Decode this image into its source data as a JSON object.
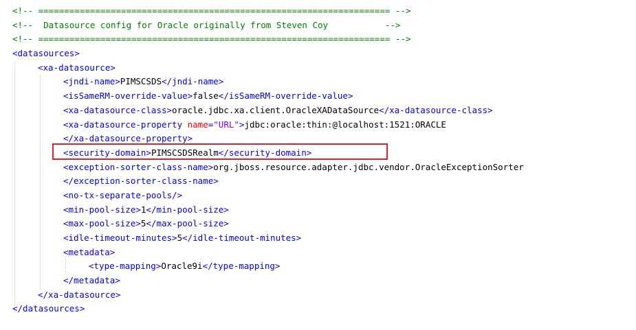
{
  "code_view": {
    "colors": {
      "comment": "#008000",
      "tag": "#0000ff",
      "text": "#000000",
      "attribute": "#ff0000",
      "attribute_value": "#8000ff",
      "highlight_box": "#e0202c"
    },
    "highlighted_line_index": 9,
    "lines": [
      {
        "indent": 0,
        "tokens": [
          {
            "t": "comment",
            "v": "<!-- ==================================================================== -->"
          }
        ]
      },
      {
        "indent": 0,
        "tokens": [
          {
            "t": "comment",
            "v": "<!--  Datasource config for Oracle originally from Steven Coy           -->"
          }
        ]
      },
      {
        "indent": 0,
        "tokens": [
          {
            "t": "comment",
            "v": "<!-- ==================================================================== -->"
          }
        ]
      },
      {
        "indent": 0,
        "tokens": [
          {
            "t": "tag",
            "v": "<datasources>"
          }
        ]
      },
      {
        "indent": 1,
        "tokens": [
          {
            "t": "tag",
            "v": "<xa-datasource>"
          }
        ]
      },
      {
        "indent": 2,
        "tokens": [
          {
            "t": "tag",
            "v": "<jndi-name>"
          },
          {
            "t": "text",
            "v": "PIMSCSDS"
          },
          {
            "t": "tag",
            "v": "</jndi-name>"
          }
        ]
      },
      {
        "indent": 2,
        "tokens": [
          {
            "t": "tag",
            "v": "<isSameRM-override-value>"
          },
          {
            "t": "text",
            "v": "false"
          },
          {
            "t": "tag",
            "v": "</isSameRM-override-value>"
          }
        ]
      },
      {
        "indent": 2,
        "tokens": [
          {
            "t": "tag",
            "v": "<xa-datasource-class>"
          },
          {
            "t": "text",
            "v": "oracle.jdbc.xa.client.OracleXADataSource"
          },
          {
            "t": "tag",
            "v": "</xa-datasource-class>"
          }
        ]
      },
      {
        "indent": 2,
        "tokens": [
          {
            "t": "tag",
            "v": "<xa-datasource-property "
          },
          {
            "t": "attr",
            "v": "name"
          },
          {
            "t": "tag",
            "v": "="
          },
          {
            "t": "attrval",
            "v": "\"URL\""
          },
          {
            "t": "tag",
            "v": ">"
          },
          {
            "t": "text",
            "v": "jdbc:oracle:thin:@localhost:1521:ORACLE"
          }
        ]
      },
      {
        "indent": 2,
        "tokens": [
          {
            "t": "tag",
            "v": "</xa-datasource-property>"
          }
        ]
      },
      {
        "indent": 2,
        "tokens": [
          {
            "t": "tag",
            "v": "<security-domain>"
          },
          {
            "t": "text",
            "v": "PIMSCSDSRealm"
          },
          {
            "t": "tag",
            "v": "</security-domain>"
          }
        ]
      },
      {
        "indent": 2,
        "tokens": [
          {
            "t": "tag",
            "v": "<exception-sorter-class-name>"
          },
          {
            "t": "text",
            "v": "org.jboss.resource.adapter.jdbc.vendor.OracleExceptionSorter"
          }
        ]
      },
      {
        "indent": 2,
        "tokens": [
          {
            "t": "tag",
            "v": "</exception-sorter-class-name>"
          }
        ]
      },
      {
        "indent": 2,
        "tokens": [
          {
            "t": "tag",
            "v": "<no-tx-separate-pools/>"
          }
        ]
      },
      {
        "indent": 2,
        "tokens": [
          {
            "t": "tag",
            "v": "<min-pool-size>"
          },
          {
            "t": "text",
            "v": "1"
          },
          {
            "t": "tag",
            "v": "</min-pool-size>"
          }
        ]
      },
      {
        "indent": 2,
        "tokens": [
          {
            "t": "tag",
            "v": "<max-pool-size>"
          },
          {
            "t": "text",
            "v": "5"
          },
          {
            "t": "tag",
            "v": "</max-pool-size>"
          }
        ]
      },
      {
        "indent": 2,
        "tokens": [
          {
            "t": "tag",
            "v": "<idle-timeout-minutes>"
          },
          {
            "t": "text",
            "v": "5"
          },
          {
            "t": "tag",
            "v": "</idle-timeout-minutes>"
          }
        ]
      },
      {
        "indent": 2,
        "tokens": [
          {
            "t": "tag",
            "v": "<metadata>"
          }
        ]
      },
      {
        "indent": 3,
        "tokens": [
          {
            "t": "tag",
            "v": "<type-mapping>"
          },
          {
            "t": "text",
            "v": "Oracle9i"
          },
          {
            "t": "tag",
            "v": "</type-mapping>"
          }
        ]
      },
      {
        "indent": 2,
        "tokens": [
          {
            "t": "tag",
            "v": "</metadata>"
          }
        ]
      },
      {
        "indent": 1,
        "tokens": [
          {
            "t": "tag",
            "v": "</xa-datasource>"
          }
        ]
      },
      {
        "indent": 0,
        "tokens": [
          {
            "t": "tag",
            "v": "</datasources>"
          }
        ]
      }
    ]
  }
}
